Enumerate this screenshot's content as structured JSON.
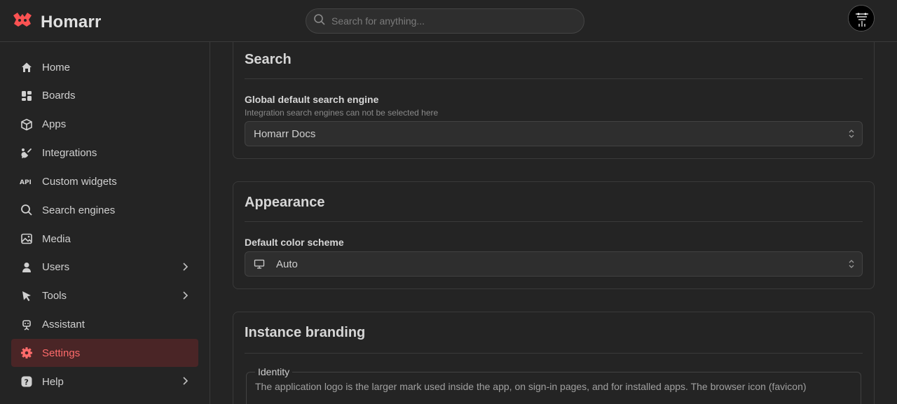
{
  "app": {
    "title": "Homarr",
    "brand_color": "#fa5252"
  },
  "search": {
    "placeholder": "Search for anything..."
  },
  "sidebar": {
    "items": [
      {
        "label": "Home",
        "icon": "home-icon"
      },
      {
        "label": "Boards",
        "icon": "boards-icon"
      },
      {
        "label": "Apps",
        "icon": "box-icon"
      },
      {
        "label": "Integrations",
        "icon": "plug-icon"
      },
      {
        "label": "Custom widgets",
        "icon": "api-icon"
      },
      {
        "label": "Search engines",
        "icon": "search-icon"
      },
      {
        "label": "Media",
        "icon": "photo-icon"
      },
      {
        "label": "Users",
        "icon": "user-icon",
        "expandable": true
      },
      {
        "label": "Tools",
        "icon": "pointer-icon",
        "expandable": true
      },
      {
        "label": "Assistant",
        "icon": "robot-icon"
      },
      {
        "label": "Settings",
        "icon": "gear-icon",
        "active": true
      },
      {
        "label": "Help",
        "icon": "question-icon",
        "expandable": true
      }
    ]
  },
  "sections": {
    "search": {
      "title": "Search",
      "field_label": "Global default search engine",
      "field_desc": "Integration search engines can not be selected here",
      "value": "Homarr Docs"
    },
    "appearance": {
      "title": "Appearance",
      "field_label": "Default color scheme",
      "value": "Auto"
    },
    "branding": {
      "title": "Instance branding",
      "legend": "Identity",
      "text": "The application logo is the larger mark used inside the app, on sign-in pages, and for installed apps. The browser icon (favicon)"
    }
  }
}
